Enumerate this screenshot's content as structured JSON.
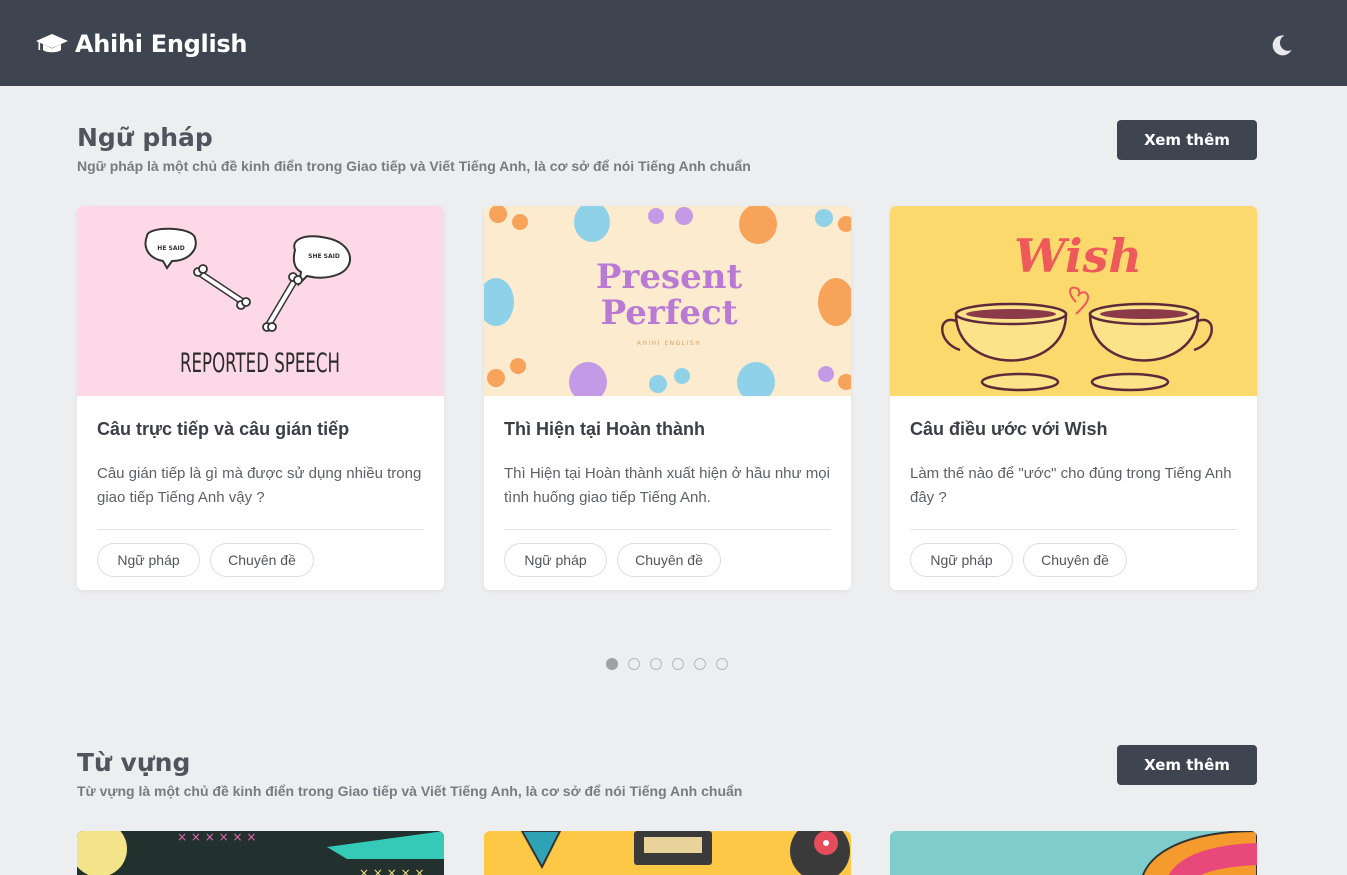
{
  "brand": {
    "name": "Ahihi English",
    "icon": "graduation-cap-icon"
  },
  "header": {
    "theme_toggle_icon": "moon-icon"
  },
  "sections": [
    {
      "title": "Ngữ pháp",
      "description": "Ngữ pháp là một chủ đề kinh điển trong Giao tiếp và Viết Tiếng Anh, là cơ sở để nói Tiếng Anh chuẩn",
      "more_label": "Xem thêm",
      "cards": [
        {
          "image_text": "REPORTED SPEECH",
          "bubble_left": "HE SAID",
          "bubble_right": "SHE SAID",
          "title": "Câu trực tiếp và câu gián tiếp",
          "description": "Câu gián tiếp là gì mà được sử dụng nhiều trong giao tiếp Tiếng Anh vậy ?",
          "tags": [
            "Ngữ pháp",
            "Chuyên đề"
          ]
        },
        {
          "image_text_line1": "Present",
          "image_text_line2": "Perfect",
          "image_caption": "AHIHI ENGLISH",
          "title": "Thì Hiện tại Hoàn thành",
          "description": "Thì Hiện tại Hoàn thành xuất hiện ở hầu như mọi tình huống giao tiếp Tiếng Anh.",
          "tags": [
            "Ngữ pháp",
            "Chuyên đề"
          ]
        },
        {
          "image_text": "Wish",
          "title": "Câu điều ước với Wish",
          "description": "Làm thế nào để \"ước\" cho đúng trong Tiếng Anh đây ?",
          "tags": [
            "Ngữ pháp",
            "Chuyên đề"
          ]
        }
      ],
      "carousel": {
        "pages": 6,
        "active": 1
      }
    },
    {
      "title": "Từ vựng",
      "description": "Từ vựng là một chủ đề kinh điển trong Giao tiếp và Viết Tiếng Anh, là cơ sở để nói Tiếng Anh chuẩn",
      "more_label": "Xem thêm"
    }
  ],
  "colors": {
    "header_bg": "#3f4550",
    "page_bg": "#edeef0",
    "card_pink": "#fdd9e7",
    "card_cream": "#fdebd0",
    "card_yellow": "#fcd96d"
  }
}
